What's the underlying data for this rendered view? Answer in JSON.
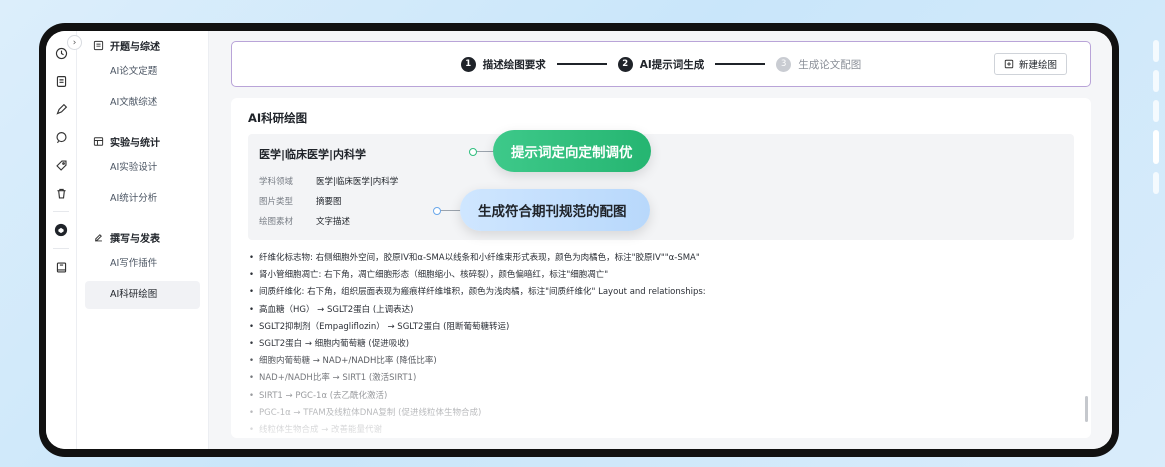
{
  "rail": {
    "icons": [
      "clock-icon",
      "document-icon",
      "pen-icon",
      "chat-icon",
      "tag-icon",
      "trash-icon",
      "shield-icon",
      "book-icon"
    ]
  },
  "nav": {
    "groups": [
      {
        "title": "开题与综述",
        "icon": "list-doc-icon",
        "items": [
          {
            "label": "AI论文定题"
          },
          {
            "label": "AI文献综述"
          }
        ]
      },
      {
        "title": "实验与统计",
        "icon": "table-icon",
        "items": [
          {
            "label": "AI实验设计"
          },
          {
            "label": "AI统计分析"
          }
        ]
      },
      {
        "title": "撰写与发表",
        "icon": "edit-icon",
        "items": [
          {
            "label": "AI写作插件"
          },
          {
            "label": "AI科研绘图"
          }
        ]
      }
    ]
  },
  "steps": [
    {
      "num": "1",
      "label": "描述绘图要求"
    },
    {
      "num": "2",
      "label": "AI提示词生成"
    },
    {
      "num": "3",
      "label": "生成论文配图"
    }
  ],
  "new_button": {
    "label": "新建绘图"
  },
  "card": {
    "title": "AI科研绘图",
    "info": {
      "title": "医学|临床医学|内科学",
      "rows": [
        {
          "key": "学科领域",
          "value": "医学|临床医学|内科学"
        },
        {
          "key": "图片类型",
          "value": "摘要图"
        },
        {
          "key": "绘图素材",
          "value": "文字描述"
        }
      ]
    },
    "callouts": [
      {
        "label": "提示词定向定制调优"
      },
      {
        "label": "生成符合期刊规范的配图"
      }
    ],
    "lines": [
      "纤维化标志物: 右侧细胞外空间，胶原IV和α-SMA以线条和小纤维束形式表现，颜色为肉橘色，标注\"胶原IV\"\"α-SMA\"",
      "肾小管细胞凋亡: 右下角，凋亡细胞形态（细胞缩小、核碎裂），颜色偏暗红，标注\"细胞凋亡\"",
      "间质纤维化: 右下角，组织层面表现为瘢痕样纤维堆积，颜色为浅肉橘，标注\"间质纤维化\" Layout and relationships:",
      "高血糖（HG） → SGLT2蛋白 (上调表达)",
      "SGLT2抑制剂（Empagliflozin） → SGLT2蛋白 (阻断葡萄糖转运)",
      "SGLT2蛋白 → 细胞内葡萄糖 (促进吸收)",
      "细胞内葡萄糖 → NAD+/NADH比率 (降低比率)",
      "NAD+/NADH比率 → SIRT1 (激活SIRT1)",
      "SIRT1 → PGC-1α (去乙酰化激活)",
      "PGC-1α → TFAM及线粒体DNA复制 (促进线粒体生物合成)",
      "线粒体生物合成 → 改善能量代谢"
    ]
  }
}
